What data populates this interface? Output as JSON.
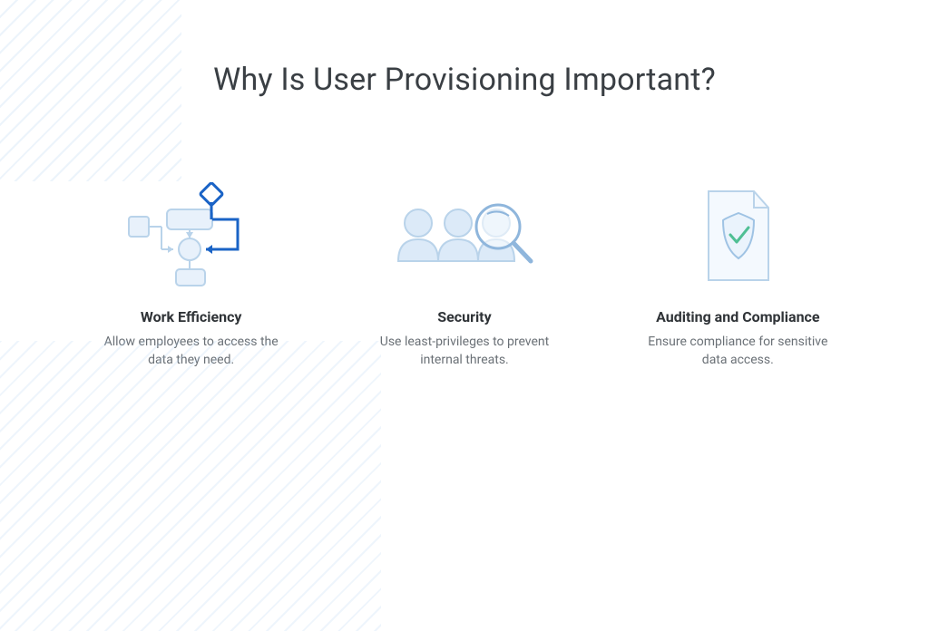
{
  "title": "Why Is User Provisioning Important?",
  "columns": [
    {
      "icon": "workflow-icon",
      "title": "Work Efficiency",
      "desc": "Allow employees to access the data they need."
    },
    {
      "icon": "people-search-icon",
      "title": "Security",
      "desc": "Use least-privileges to prevent internal threats."
    },
    {
      "icon": "document-shield-check-icon",
      "title": "Auditing and Compliance",
      "desc": "Ensure compliance for sensitive data access."
    }
  ],
  "colors": {
    "icon_light": "#cfe2f5",
    "icon_stroke": "#b9d3ea",
    "icon_bold": "#1a63c6",
    "accent_green": "#4fbf94",
    "text_heading": "#3a3f44",
    "text_title": "#2f3337",
    "text_body": "#6a7076"
  }
}
